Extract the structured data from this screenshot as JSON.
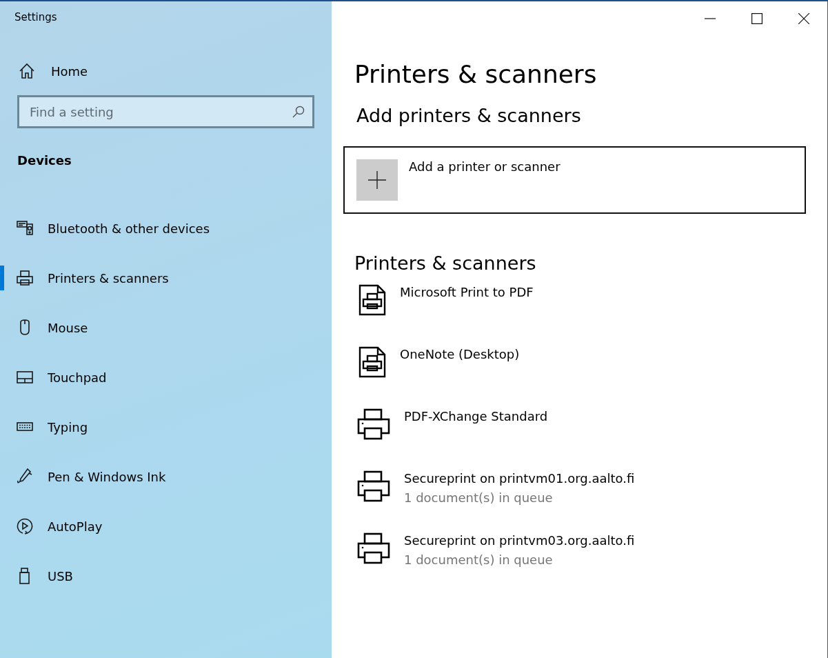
{
  "window": {
    "title": "Settings"
  },
  "sidebar": {
    "home": "Home",
    "search": {
      "placeholder": "Find a setting"
    },
    "section": "Devices",
    "items": [
      {
        "label": "Bluetooth & other devices",
        "kind": "bluetooth",
        "selected": false
      },
      {
        "label": "Printers & scanners",
        "kind": "printer",
        "selected": true
      },
      {
        "label": "Mouse",
        "kind": "mouse",
        "selected": false
      },
      {
        "label": "Touchpad",
        "kind": "touchpad",
        "selected": false
      },
      {
        "label": "Typing",
        "kind": "keyboard",
        "selected": false
      },
      {
        "label": "Pen & Windows Ink",
        "kind": "pen",
        "selected": false
      },
      {
        "label": "AutoPlay",
        "kind": "autoplay",
        "selected": false
      },
      {
        "label": "USB",
        "kind": "usb",
        "selected": false
      }
    ]
  },
  "page": {
    "title": "Printers & scanners",
    "add_heading": "Add printers & scanners",
    "add_button": "Add a printer or scanner",
    "list_heading": "Printers & scanners",
    "printers": [
      {
        "name": "Microsoft Print to PDF",
        "kind": "document"
      },
      {
        "name": "OneNote (Desktop)",
        "kind": "document"
      },
      {
        "name": "PDF-XChange Standard",
        "kind": "printer"
      },
      {
        "name": "Secureprint on printvm01.org.aalto.fi",
        "kind": "printer",
        "status": "1 document(s) in queue"
      },
      {
        "name": "Secureprint on printvm03.org.aalto.fi",
        "kind": "printer",
        "status": "1 document(s) in queue"
      }
    ]
  }
}
